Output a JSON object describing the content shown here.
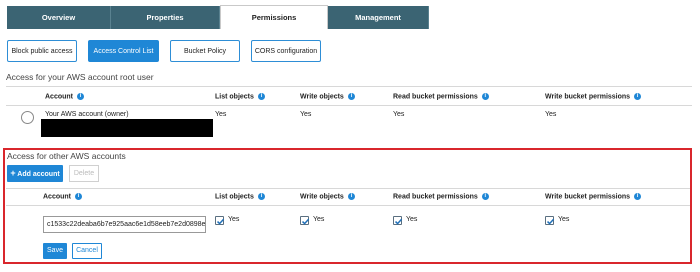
{
  "tabs": [
    "Overview",
    "Properties",
    "Permissions",
    "Management"
  ],
  "subtabs": [
    "Block public access",
    "Access Control List",
    "Bucket Policy",
    "CORS configuration"
  ],
  "colors": {
    "accent": "#1f87d6",
    "tab_bg": "#3b6473",
    "highlight_border": "#d9262c"
  },
  "root_section": {
    "title": "Access for your AWS account root user",
    "headers": [
      "Account",
      "List objects",
      "Write objects",
      "Read bucket permissions",
      "Write bucket permissions"
    ],
    "row": {
      "account": "Your AWS account (owner)",
      "list_objects": "Yes",
      "write_objects": "Yes",
      "read_bucket": "Yes",
      "write_bucket": "Yes"
    }
  },
  "other_section": {
    "title": "Access for other AWS accounts",
    "add_button": "Add account",
    "delete_button": "Delete",
    "headers": [
      "Account",
      "List objects",
      "Write objects",
      "Read bucket permissions",
      "Write bucket permissions"
    ],
    "row": {
      "account_value": "c1533c22deaba6b7e925aac6e1d58eeb7e2d0898ef",
      "list_objects": "Yes",
      "write_objects": "Yes",
      "read_bucket": "Yes",
      "write_bucket": "Yes"
    },
    "save_button": "Save",
    "cancel_button": "Cancel"
  }
}
